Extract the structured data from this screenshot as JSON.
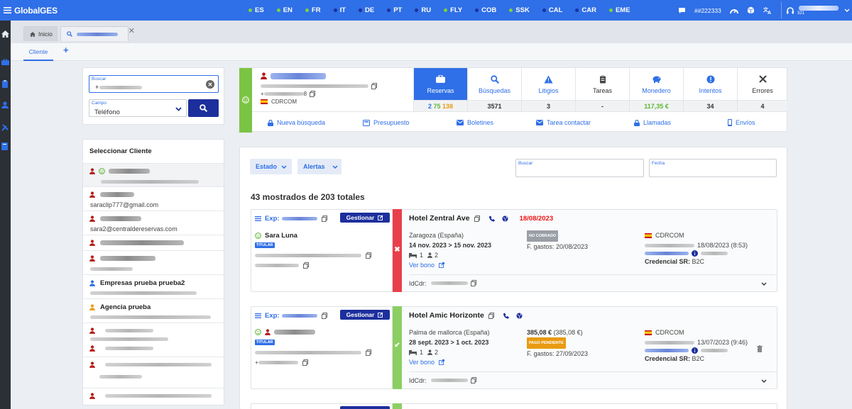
{
  "app": {
    "brand": "GlobalGES",
    "user_id": "##222333",
    "user_sub": "321"
  },
  "langs": [
    {
      "code": "ES",
      "dot": "#7bd43a"
    },
    {
      "code": "EN",
      "dot": "#7bd43a"
    },
    {
      "code": "FR",
      "dot": "#7bd43a"
    },
    {
      "code": "IT",
      "dot": "#1c2f9c"
    },
    {
      "code": "DE",
      "dot": "#1c2f9c"
    },
    {
      "code": "PT",
      "dot": "#1c2f9c"
    },
    {
      "code": "RU",
      "dot": "#1c2f9c"
    },
    {
      "code": "FLY",
      "dot": "#7bd43a"
    },
    {
      "code": "COB",
      "dot": "#1c2f9c"
    },
    {
      "code": "SSK",
      "dot": "#7bd43a"
    },
    {
      "code": "CAL",
      "dot": "#1c2f9c"
    },
    {
      "code": "CAR",
      "dot": "#1c2f9c"
    },
    {
      "code": "EME",
      "dot": "#7bd43a"
    }
  ],
  "tabs": {
    "home": "Inicio",
    "sub_cliente": "Cliente",
    "sub_add": "+"
  },
  "search": {
    "buscar_label": "Buscar",
    "buscar_value": "+",
    "campo_label": "Campo",
    "campo_value": "Teléfono"
  },
  "select_client": {
    "title": "Seleccionar Cliente",
    "items": [
      {
        "email": "saraclip777@gmail.com"
      },
      {
        "email": "sara2@centraldereservas.com"
      },
      {
        "name": "Empresas prueba prueba2"
      },
      {
        "name": "Agencia prueba"
      }
    ]
  },
  "profile": {
    "phone_suffix": "8",
    "agency": "CDRCOM",
    "stats": [
      {
        "label": "Reservas",
        "icon": "briefcase-icon"
      },
      {
        "label": "Búsquedas",
        "icon": "search-icon",
        "value": "3571"
      },
      {
        "label": "Litigios",
        "icon": "warning-icon",
        "value": "3"
      },
      {
        "label": "Tareas",
        "icon": "clipboard-icon",
        "value": "-"
      },
      {
        "label": "Monedero",
        "icon": "piggy-bank-icon",
        "value": "117,35 €"
      },
      {
        "label": "Intentos",
        "icon": "alert-icon",
        "value": "34"
      },
      {
        "label": "Errores",
        "icon": "x-icon",
        "value": "4"
      }
    ],
    "reservas_counts": [
      "2",
      "75",
      "138"
    ],
    "actions": [
      "Nueva búsqueda",
      "Presupuesto",
      "Boletines",
      "Tarea contactar",
      "Llamadas",
      "Envíos"
    ]
  },
  "bookings": {
    "filters": {
      "estado": "Estado",
      "alertas": "Alertas",
      "buscar": "Buscar",
      "fecha": "Fecha"
    },
    "count": "43 mostrados de 203 totales",
    "items": [
      {
        "exp_label": "Exp:",
        "gestionar": "Gestionar",
        "titular_name": "Sara Luna",
        "titular": "TITULAR",
        "hotel": "Hotel Zentral Ave",
        "alert_date": "18/08/2023",
        "city": "Zaragoza (España)",
        "dates": "14 nov. 2023 > 15 nov. 2023",
        "rooms": "1",
        "guests": "2",
        "ver_bono": "Ver bono",
        "status_badge": "NO COBRADO",
        "gastos": "F. gastos: 20/08/2023",
        "agency": "CDRCOM",
        "created": "18/08/2023 (8:53)",
        "credencial_label": "Credencial SR:",
        "credencial": "B2C",
        "idcdr_label": "IdCdr:"
      },
      {
        "exp_label": "Exp:",
        "gestionar": "Gestionar",
        "titular": "TITULAR",
        "phone_prefix": "+",
        "hotel": "Hotel Amic Horizonte",
        "city": "Palma de mallorca (España)",
        "dates": "28 sept. 2023 > 1 oct. 2023",
        "rooms": "1",
        "guests": "2",
        "ver_bono": "Ver bono",
        "price": "385,08 €",
        "price_orig": "(385,08 €)",
        "status_badge": "PAGO PENDIENTE",
        "gastos": "F. gastos: 27/09/2023",
        "agency": "CDRCOM",
        "created": "13/07/2023 (9:46)",
        "credencial_label": "Credencial SR:",
        "credencial": "B2C",
        "idcdr_label": "IdCdr:"
      }
    ]
  }
}
